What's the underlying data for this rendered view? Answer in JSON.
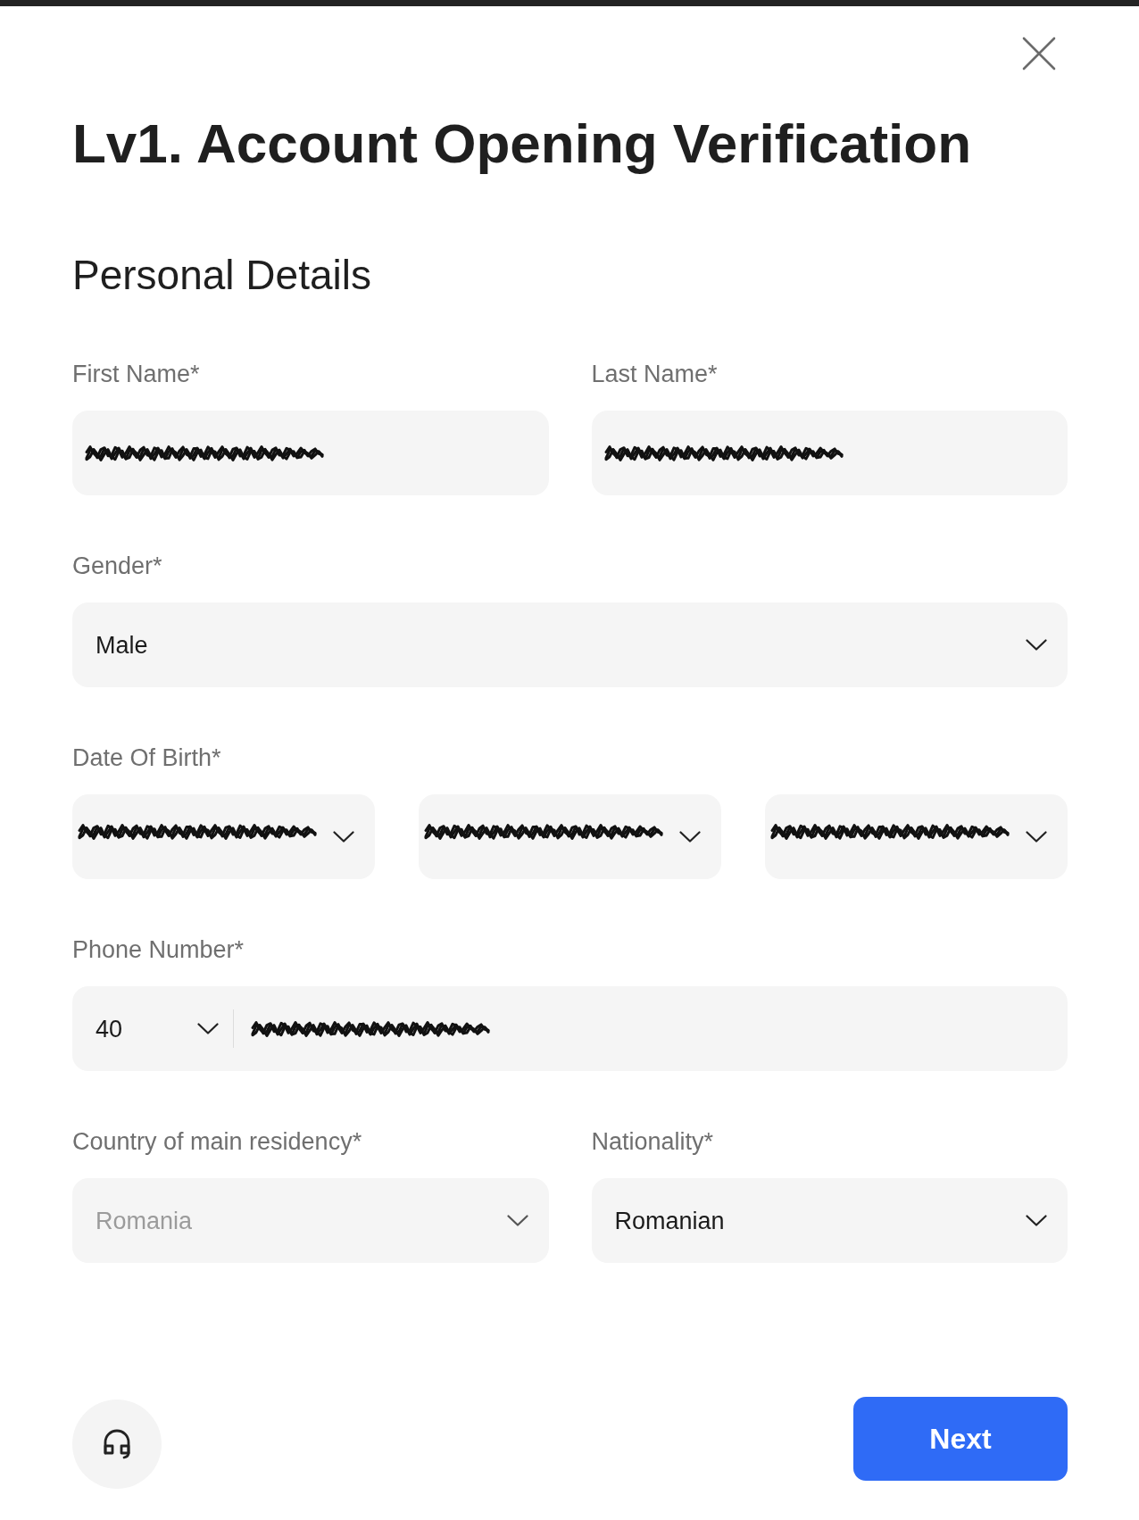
{
  "title": "Lv1. Account Opening Verification",
  "section_title": "Personal Details",
  "form": {
    "rows": [
      {
        "groups": [
          {
            "label": "First Name*",
            "controls": [
              {
                "kind": "text",
                "redacted": true,
                "disabled": false
              }
            ]
          },
          {
            "label": "Last Name*",
            "controls": [
              {
                "kind": "text",
                "redacted": true,
                "disabled": false
              }
            ]
          }
        ]
      },
      {
        "groups": [
          {
            "label": "Gender*",
            "controls": [
              {
                "kind": "select",
                "value": "Male",
                "redacted": false,
                "disabled": false
              }
            ]
          }
        ]
      },
      {
        "groups": [
          {
            "label": "Date Of Birth*",
            "controls": [
              {
                "kind": "select",
                "redacted": true,
                "disabled": false
              },
              {
                "kind": "select",
                "redacted": true,
                "disabled": false
              },
              {
                "kind": "select",
                "redacted": true,
                "disabled": false
              }
            ]
          }
        ]
      },
      {
        "groups": [
          {
            "label": "Phone Number*",
            "controls": [
              {
                "kind": "phone",
                "code": "40",
                "redacted": true,
                "disabled": false
              }
            ]
          }
        ]
      },
      {
        "groups": [
          {
            "label": "Country of main residency*",
            "controls": [
              {
                "kind": "select",
                "value": "Romania",
                "redacted": false,
                "disabled": true
              }
            ]
          },
          {
            "label": "Nationality*",
            "controls": [
              {
                "kind": "select",
                "value": "Romanian",
                "redacted": false,
                "disabled": false
              }
            ]
          }
        ]
      }
    ]
  },
  "next_button": {
    "label": "Next"
  }
}
